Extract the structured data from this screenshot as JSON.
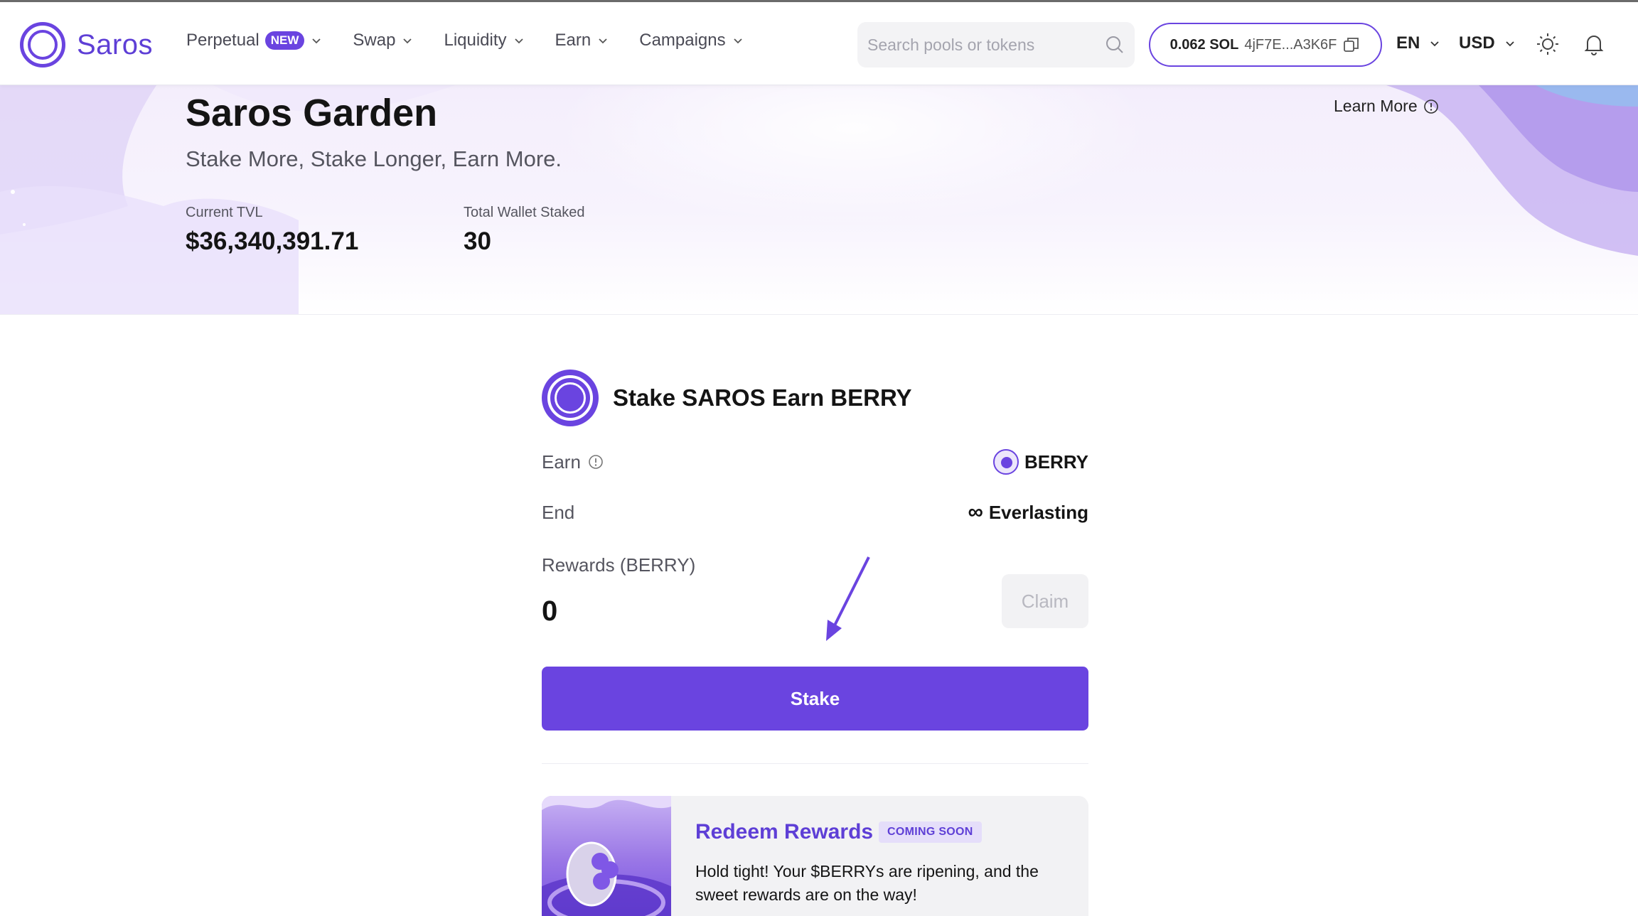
{
  "brand": {
    "name": "Saros",
    "accent": "#6a44e0"
  },
  "nav": {
    "items": [
      {
        "label": "Perpetual",
        "badge": "NEW"
      },
      {
        "label": "Swap"
      },
      {
        "label": "Liquidity"
      },
      {
        "label": "Earn"
      },
      {
        "label": "Campaigns"
      }
    ]
  },
  "search": {
    "placeholder": "Search pools or tokens"
  },
  "wallet": {
    "balance": "0.062 SOL",
    "address": "4jF7E...A3K6F"
  },
  "language": {
    "value": "EN"
  },
  "currency": {
    "value": "USD"
  },
  "hero": {
    "title": "Saros Garden",
    "subtitle": "Stake More, Stake Longer, Earn More.",
    "learn_more": "Learn More",
    "stats": [
      {
        "label": "Current TVL",
        "value": "$36,340,391.71"
      },
      {
        "label": "Total Wallet Staked",
        "value": "30"
      }
    ]
  },
  "pool": {
    "title": "Stake SAROS Earn BERRY",
    "earn_label": "Earn",
    "earn_token": "BERRY",
    "end_label": "End",
    "end_symbol": "∞",
    "end_value": "Everlasting",
    "rewards_label": "Rewards (BERRY)",
    "rewards_value": "0",
    "claim_label": "Claim",
    "stake_label": "Stake"
  },
  "redeem": {
    "title": "Redeem Rewards",
    "badge": "COMING SOON",
    "text": "Hold tight! Your $BERRYs are ripening, and the sweet rewards are on the way!"
  }
}
